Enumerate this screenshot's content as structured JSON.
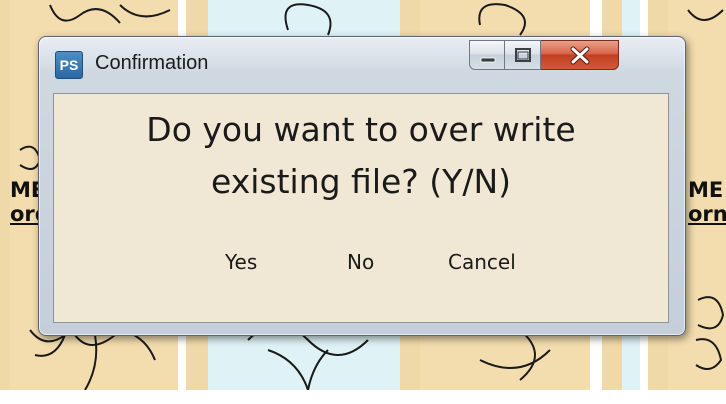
{
  "window": {
    "title": "Confirmation",
    "app_icon_label": "PS",
    "controls": [
      "minimize-icon",
      "maximize-icon",
      "close-icon"
    ]
  },
  "dialog": {
    "message_line1": "Do you want to over write",
    "message_line2": "existing file? (Y/N)",
    "buttons": {
      "yes": "Yes",
      "no": "No",
      "cancel": "Cancel"
    }
  },
  "background": {
    "partial_text_left_1": "ME",
    "partial_text_left_2": "ord",
    "partial_text_right_1": "ME",
    "partial_text_right_2": "orn"
  },
  "colors": {
    "tan_tile": "#f0d9a8",
    "blue_tile": "#dff3f6",
    "dialog_body": "#f1e7d5",
    "close_button": "#c94a2c"
  }
}
